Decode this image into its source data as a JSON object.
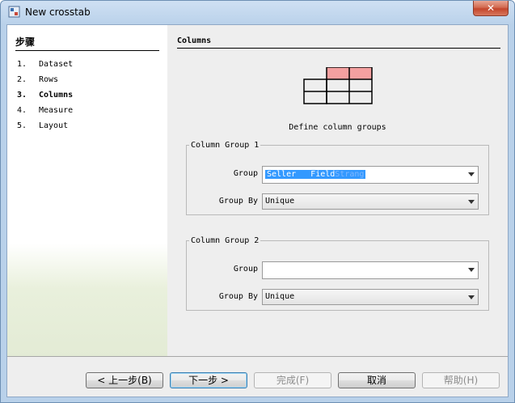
{
  "window": {
    "title": "New crosstab",
    "close_glyph": "✕"
  },
  "steps": {
    "title": "步骤",
    "items": [
      {
        "num": "1.",
        "label": "Dataset"
      },
      {
        "num": "2.",
        "label": "Rows"
      },
      {
        "num": "3.",
        "label": "Columns"
      },
      {
        "num": "4.",
        "label": "Measure"
      },
      {
        "num": "5.",
        "label": "Layout"
      }
    ]
  },
  "page": {
    "title": "Columns",
    "caption": "Define column groups",
    "groups": [
      {
        "legend": "Column Group 1",
        "group_label": "Group",
        "group_value": "Seller   Field",
        "group_value_ghost": "Strang",
        "group_by_label": "Group By",
        "group_by_value": "Unique"
      },
      {
        "legend": "Column Group 2",
        "group_label": "Group",
        "group_value": "",
        "group_by_label": "Group By",
        "group_by_value": "Unique"
      }
    ]
  },
  "buttons": {
    "back": "< 上一步(B)",
    "next": "下一步 >",
    "finish": "完成(F)",
    "cancel": "取消",
    "help": "帮助(H)"
  },
  "colors": {
    "accent_selection": "#3399ff",
    "grid_highlight": "#f4a0a0"
  }
}
